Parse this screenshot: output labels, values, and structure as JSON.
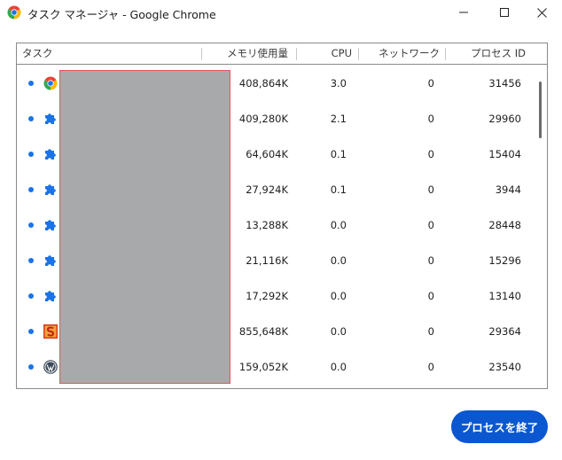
{
  "window": {
    "title": "タスク マネージャ - Google Chrome",
    "app_icon": "chrome-icon",
    "controls": [
      "minimize-icon",
      "maximize-icon",
      "close-icon"
    ]
  },
  "table": {
    "headers": {
      "task": "タスク",
      "memory": "メモリ使用量",
      "cpu": "CPU",
      "network": "ネットワーク",
      "pid": "プロセス ID"
    },
    "rows": [
      {
        "icon": "chrome-icon",
        "memory": "408,864K",
        "cpu": "3.0",
        "network": "0",
        "pid": "31456"
      },
      {
        "icon": "extension-puzzle-icon",
        "memory": "409,280K",
        "cpu": "2.1",
        "network": "0",
        "pid": "29960"
      },
      {
        "icon": "extension-puzzle-icon",
        "memory": "64,604K",
        "cpu": "0.1",
        "network": "0",
        "pid": "15404"
      },
      {
        "icon": "extension-puzzle-icon",
        "memory": "27,924K",
        "cpu": "0.1",
        "network": "0",
        "pid": "3944"
      },
      {
        "icon": "extension-puzzle-icon",
        "memory": "13,288K",
        "cpu": "0.0",
        "network": "0",
        "pid": "28448"
      },
      {
        "icon": "extension-puzzle-icon",
        "memory": "21,116K",
        "cpu": "0.0",
        "network": "0",
        "pid": "15296"
      },
      {
        "icon": "extension-puzzle-icon",
        "memory": "17,292K",
        "cpu": "0.0",
        "network": "0",
        "pid": "13140"
      },
      {
        "icon": "red-s-favicon-icon",
        "memory": "855,648K",
        "cpu": "0.0",
        "network": "0",
        "pid": "29364"
      },
      {
        "icon": "wordpress-icon",
        "memory": "159,052K",
        "cpu": "0.0",
        "network": "0",
        "pid": "23540"
      }
    ]
  },
  "actions": {
    "end_process_label": "プロセスを終了"
  },
  "colors": {
    "accent": "#0b57d0",
    "row_dot": "#1a73e8",
    "redaction_fill": "#a8a9ab",
    "redaction_border": "#e0575b"
  }
}
